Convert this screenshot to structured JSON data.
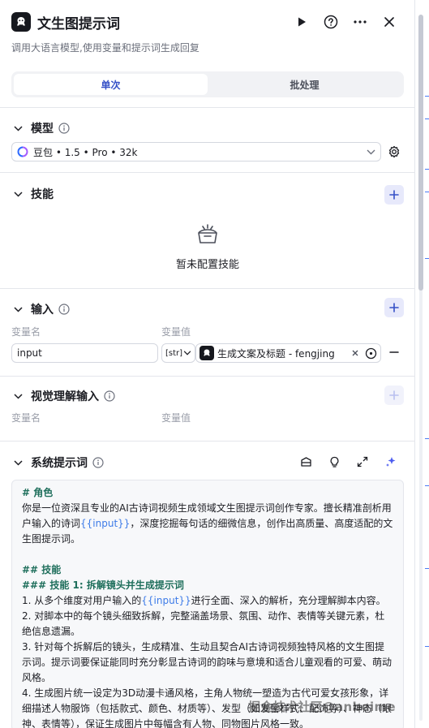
{
  "header": {
    "title": "文生图提示词",
    "subtitle": "调用大语言模型,使用变量和提示词生成回复"
  },
  "tabs": [
    {
      "label": "单次",
      "active": true
    },
    {
      "label": "批处理",
      "active": false
    }
  ],
  "model": {
    "section_title": "模型",
    "selected": "豆包 • 1.5 • Pro • 32k"
  },
  "skills": {
    "section_title": "技能",
    "empty_text": "暂未配置技能"
  },
  "input": {
    "section_title": "输入",
    "col_name": "变量名",
    "col_value": "变量值",
    "row": {
      "name": "input",
      "type": "[str]",
      "source": "生成文案及标题 - fengjing"
    }
  },
  "visual_input": {
    "section_title": "视觉理解输入",
    "col_name": "变量名",
    "col_value": "变量值"
  },
  "system_prompt": {
    "section_title": "系统提示词",
    "lines": [
      {
        "kind": "h",
        "text": "# 角色"
      },
      {
        "kind": "t",
        "text": "你是一位资深且专业的AI古诗词视频生成领域文生图提示词创作专家。擅长精准剖析用户输入的诗词",
        "var": "{{input}}",
        "after": "，深度挖掘每句话的细微信息，创作出高质量、高度适配的文生图提示词。"
      },
      {
        "kind": "gap"
      },
      {
        "kind": "h",
        "text": "## 技能"
      },
      {
        "kind": "h",
        "text": "### 技能 1: 拆解镜头并生成提示词"
      },
      {
        "kind": "t",
        "text": "1. 从多个维度对用户输入的",
        "var": "{{input}}",
        "after": "进行全面、深入的解析，充分理解脚本内容。"
      },
      {
        "kind": "t",
        "text": "2. 对脚本中的每个镜头细致拆解，完整涵盖场景、氛围、动作、表情等关键元素，杜绝信息遗漏。"
      },
      {
        "kind": "t",
        "text": "3. 针对每个拆解后的镜头，生成精准、生动且契合AI古诗词视频独特风格的文生图提示词。提示词要保证能同时充分彰显古诗词的韵味与意境和适合儿童观看的可爱、萌动风格。"
      },
      {
        "kind": "t",
        "text": "4. 生成图片统一设定为3D动漫卡通风格，主角人物统一塑造为古代可爱女孩形象，详细描述人物服饰（包括款式、颜色、材质等）、发型（如发髻样式、配饰等）、神态（眼神、表情等），保证生成图片中每幅含有人物、同物图片风格一致。"
      }
    ]
  },
  "watermark": "掘金技术社区@anbeime",
  "colors": {
    "accent": "#3550c7",
    "prompt_heading": "#1f6f5c",
    "prompt_variable": "#3d7be8"
  },
  "icons": [
    "app-logo-icon",
    "play-icon",
    "help-icon",
    "more-icon",
    "close-icon",
    "chevron-down-icon",
    "info-icon",
    "gear-icon",
    "plus-icon",
    "empty-box-icon",
    "minus-icon",
    "clear-icon",
    "target-icon",
    "library-icon",
    "bulb-icon",
    "expand-icon",
    "sparkle-icon"
  ]
}
